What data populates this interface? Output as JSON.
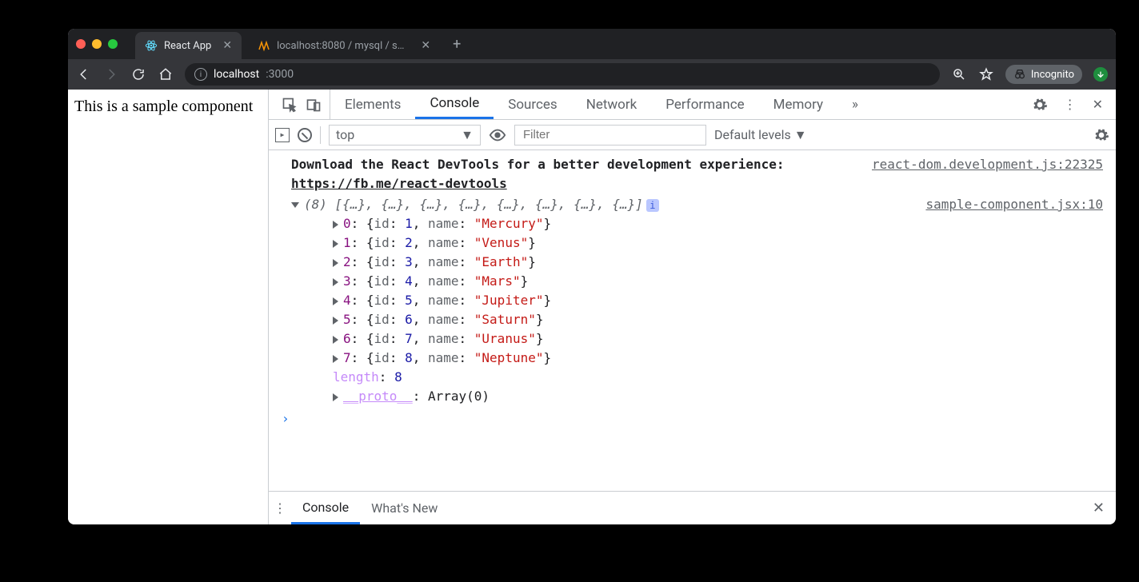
{
  "tabs": [
    {
      "title": "React App",
      "favicon": "react"
    },
    {
      "title": "localhost:8080 / mysql / sampl",
      "favicon": "phpmyadmin"
    }
  ],
  "address": {
    "host": "localhost",
    "path": ":3000"
  },
  "incognito_label": "Incognito",
  "page_text": "This is a sample component",
  "devtools": {
    "tabs": [
      "Elements",
      "Console",
      "Sources",
      "Network",
      "Performance",
      "Memory"
    ],
    "active_tab": "Console",
    "toolbar": {
      "context": "top",
      "filter_placeholder": "Filter",
      "levels_label": "Default levels"
    },
    "messages": {
      "devtools_hint": {
        "text": "Download the React DevTools for a better development experience: ",
        "link": "https://fb.me/react-devtools",
        "source": "react-dom.development.js:22325"
      },
      "array_log": {
        "source": "sample-component.jsx:10",
        "count": 8,
        "summary": "[{…}, {…}, {…}, {…}, {…}, {…}, {…}, {…}]",
        "entries": [
          {
            "index": 0,
            "id": 1,
            "name": "Mercury"
          },
          {
            "index": 1,
            "id": 2,
            "name": "Venus"
          },
          {
            "index": 2,
            "id": 3,
            "name": "Earth"
          },
          {
            "index": 3,
            "id": 4,
            "name": "Mars"
          },
          {
            "index": 4,
            "id": 5,
            "name": "Jupiter"
          },
          {
            "index": 5,
            "id": 6,
            "name": "Saturn"
          },
          {
            "index": 6,
            "id": 7,
            "name": "Uranus"
          },
          {
            "index": 7,
            "id": 8,
            "name": "Neptune"
          }
        ],
        "length_label": "length",
        "length_value": 8,
        "proto_label": "__proto__",
        "proto_value": "Array(0)"
      }
    },
    "drawer": {
      "tabs": [
        "Console",
        "What's New"
      ],
      "active": "Console"
    }
  }
}
